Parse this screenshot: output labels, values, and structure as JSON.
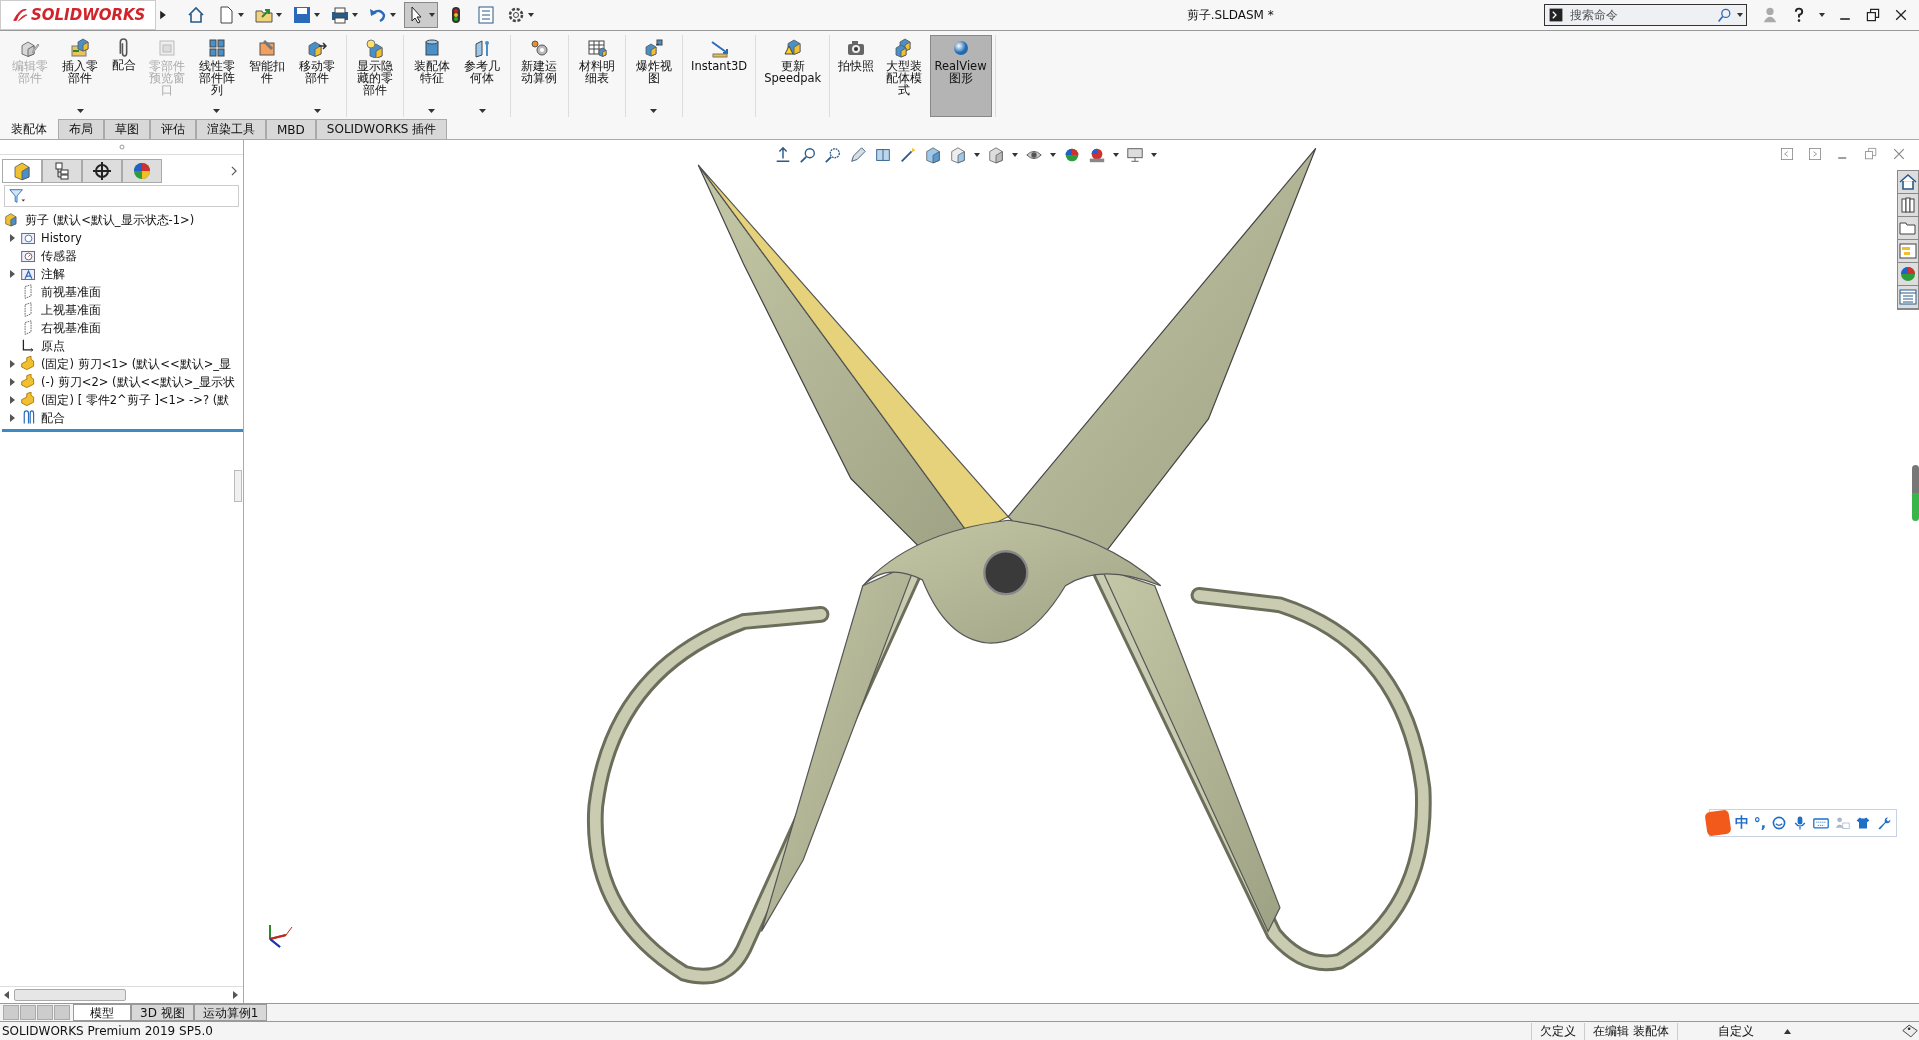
{
  "title_bar": {
    "logo": "SOLIDWORKS",
    "document_title": "剪子.SLDASM *",
    "search": {
      "placeholder": "搜索命令"
    }
  },
  "ribbon": {
    "groups": [
      [
        {
          "label": "编辑零部件",
          "kind": "part-pencil",
          "disabled": true,
          "dropdown": false,
          "on": false
        },
        {
          "label": "插入零部件",
          "kind": "part-folder",
          "disabled": false,
          "dropdown": true,
          "on": false
        },
        {
          "label": "配合",
          "kind": "paperclip",
          "disabled": false,
          "dropdown": false,
          "on": false
        },
        {
          "label": "零部件预览窗口",
          "kind": "window",
          "disabled": true,
          "dropdown": false,
          "on": false
        },
        {
          "label": "线性零部件阵列",
          "kind": "grid",
          "disabled": false,
          "dropdown": true,
          "on": false
        },
        {
          "label": "智能扣件",
          "kind": "bolt",
          "disabled": false,
          "dropdown": false,
          "on": false
        },
        {
          "label": "移动零部件",
          "kind": "part-arrow",
          "disabled": false,
          "dropdown": true,
          "on": false
        }
      ],
      [
        {
          "label": "显示隐藏的零部件",
          "kind": "part-bulb",
          "disabled": false,
          "dropdown": false,
          "on": false
        }
      ],
      [
        {
          "label": "装配体特征",
          "kind": "cylinder",
          "disabled": false,
          "dropdown": true,
          "on": false
        },
        {
          "label": "参考几何体",
          "kind": "plane",
          "disabled": false,
          "dropdown": true,
          "on": false
        }
      ],
      [
        {
          "label": "新建运动算例",
          "kind": "gears",
          "disabled": false,
          "dropdown": false,
          "on": false
        }
      ],
      [
        {
          "label": "材料明细表",
          "kind": "table",
          "disabled": false,
          "dropdown": false,
          "on": false
        }
      ],
      [
        {
          "label": "爆炸视图",
          "kind": "explode",
          "disabled": false,
          "dropdown": true,
          "on": false
        }
      ],
      [
        {
          "label": "Instant3D",
          "kind": "ruler",
          "disabled": false,
          "dropdown": false,
          "on": false
        }
      ],
      [
        {
          "label": "更新Speedpak",
          "kind": "part-warning",
          "disabled": false,
          "dropdown": false,
          "on": false
        }
      ],
      [
        {
          "label": "拍快照",
          "kind": "camera",
          "disabled": false,
          "dropdown": false,
          "on": false
        },
        {
          "label": "大型装配体模式",
          "kind": "part-stack",
          "disabled": false,
          "dropdown": false,
          "on": false
        },
        {
          "label": "RealView图形",
          "kind": "sphere",
          "disabled": false,
          "dropdown": false,
          "on": true
        }
      ]
    ]
  },
  "command_tabs": [
    {
      "label": "装配体",
      "selected": true
    },
    {
      "label": "布局",
      "selected": false
    },
    {
      "label": "草图",
      "selected": false
    },
    {
      "label": "评估",
      "selected": false
    },
    {
      "label": "渲染工具",
      "selected": false
    },
    {
      "label": "MBD",
      "selected": false
    },
    {
      "label": "SOLIDWORKS 插件",
      "selected": false
    }
  ],
  "manager_tabs": [
    {
      "kind": "tree",
      "selected": true
    },
    {
      "kind": "properties",
      "selected": false
    },
    {
      "kind": "crosshair",
      "selected": false
    },
    {
      "kind": "appearance",
      "selected": false
    }
  ],
  "feature_tree": {
    "root": {
      "label": "剪子  (默认<默认_显示状态-1>)",
      "kind": "assembly",
      "children": [
        {
          "label": "History",
          "kind": "history",
          "expanded": false
        },
        {
          "label": "传感器",
          "kind": "sensor"
        },
        {
          "label": "注解",
          "kind": "annotation",
          "expanded": false
        },
        {
          "label": "前视基准面",
          "kind": "plane"
        },
        {
          "label": "上视基准面",
          "kind": "plane"
        },
        {
          "label": "右视基准面",
          "kind": "plane"
        },
        {
          "label": "原点",
          "kind": "origin"
        },
        {
          "label": "(固定) 剪刀<1> (默认<<默认>_显",
          "kind": "part",
          "expanded": false
        },
        {
          "label": "(-) 剪刀<2> (默认<<默认>_显示状",
          "kind": "part",
          "expanded": false
        },
        {
          "label": "(固定) [ 零件2^剪子 ]<1> ->? (默",
          "kind": "part",
          "expanded": false
        },
        {
          "label": "配合",
          "kind": "mates",
          "expanded": false
        }
      ]
    }
  },
  "ime_bar": {
    "mode": "中",
    "punctuation": "°,"
  },
  "bottom_tabs": [
    {
      "label": "模型",
      "selected": true
    },
    {
      "label": "3D 视图",
      "selected": false
    },
    {
      "label": "运动算例1",
      "selected": false
    }
  ],
  "status_bar": {
    "product": "SOLIDWORKS Premium 2019 SP5.0",
    "definition": "欠定义",
    "editing": "在编辑 装配体",
    "units": "自定义"
  }
}
